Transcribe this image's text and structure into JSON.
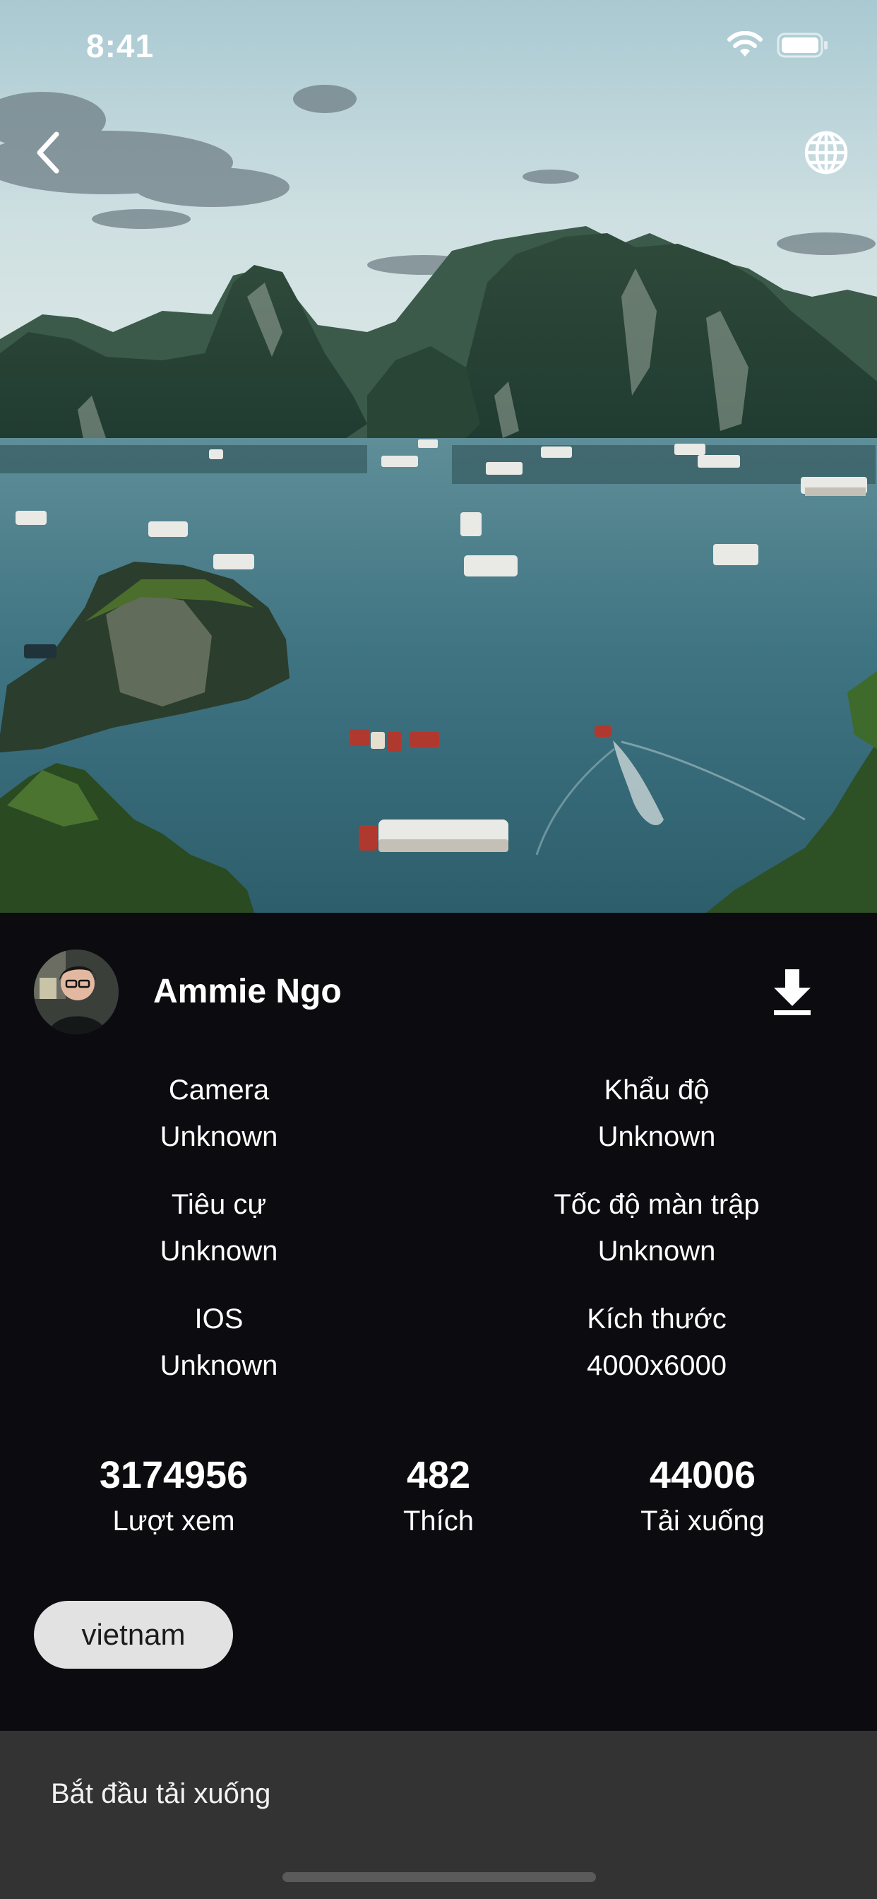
{
  "status_bar": {
    "time": "8:41"
  },
  "photo": {
    "icons": {
      "back": "chevron-left-icon",
      "language": "globe-icon"
    }
  },
  "author": {
    "name": "Ammie Ngo",
    "download_icon": "download-icon"
  },
  "meta": [
    {
      "label": "Camera",
      "value": "Unknown"
    },
    {
      "label": "Khẩu độ",
      "value": "Unknown"
    },
    {
      "label": "Tiêu cự",
      "value": "Unknown"
    },
    {
      "label": "Tốc độ màn trập",
      "value": "Unknown"
    },
    {
      "label": "IOS",
      "value": "Unknown"
    },
    {
      "label": "Kích thước",
      "value": "4000x6000"
    }
  ],
  "stats": [
    {
      "value": "3174956",
      "label": "Lượt xem"
    },
    {
      "value": "482",
      "label": "Thích"
    },
    {
      "value": "44006",
      "label": "Tải xuống"
    }
  ],
  "tags": [
    "vietnam"
  ],
  "snackbar": {
    "message": "Bắt đầu tải xuống"
  },
  "colors": {
    "background": "#0c0c10",
    "snackbar": "#333333",
    "chip": "#e2e2e2",
    "text": "#ffffff"
  }
}
